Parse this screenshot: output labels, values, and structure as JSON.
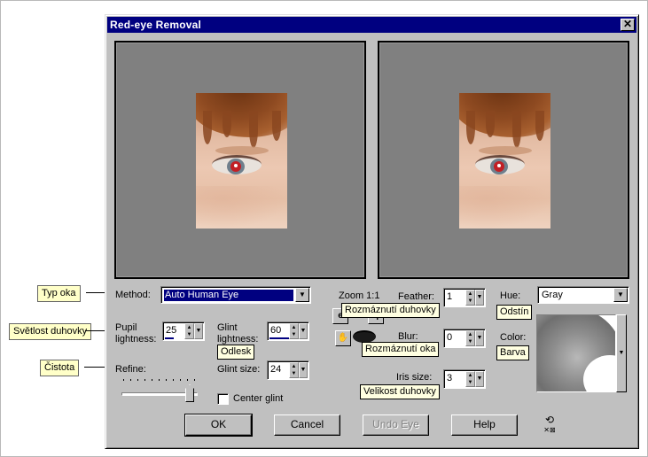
{
  "dialog": {
    "title": "Red-eye Removal",
    "close_symbol": "✕"
  },
  "controls": {
    "method_label": "Method:",
    "method_value": "Auto Human Eye",
    "pupil_label_1": "Pupil",
    "pupil_label_2": "lightness:",
    "pupil_value": "25",
    "pupil_fill": 0.25,
    "glint_lightness_label_1": "Glint",
    "glint_lightness_label_2": "lightness:",
    "glint_lightness_value": "60",
    "glint_lightness_fill": 0.6,
    "glint_size_label": "Glint size:",
    "glint_size_value": "24",
    "refine_label": "Refine:",
    "refine_level": 1.0,
    "center_glint_label": "Center glint",
    "center_glint_checked": false,
    "zoom_label": "Zoom 1:1",
    "feather_label": "Feather:",
    "feather_value": "1",
    "blur_label": "Blur:",
    "blur_value": "0",
    "iris_size_label": "Iris size:",
    "iris_size_value": "3",
    "hue_label": "Hue:",
    "hue_value": "Gray",
    "color_label": "Color:"
  },
  "buttons": {
    "ok": "OK",
    "cancel": "Cancel",
    "undo_eye": "Undo Eye",
    "help": "Help"
  },
  "tooltips": {
    "zoom_area": "Rozmáznutí duhovky",
    "blur": "Rozmáznutí oka",
    "iris_size": "Velikost duhovky",
    "glint_size": "Odlesk",
    "hue": "Odstín",
    "color": "Barva"
  },
  "callouts": {
    "method": "Typ oka",
    "pupil": "Světlost duhovky",
    "refine": "Čistota"
  },
  "icons": {
    "zoom_in": "zoom-in-icon",
    "zoom_out": "zoom-out-icon",
    "pan": "pan-hand-icon",
    "eye": "eye-icon",
    "reset": "reset-icon"
  },
  "colors": {
    "titlebar": "#000080",
    "dialog_bg": "#c0c0c0",
    "pane_bg": "#808080",
    "pupil_red": "#c21f25",
    "callout_bg": "#ffffc8"
  }
}
